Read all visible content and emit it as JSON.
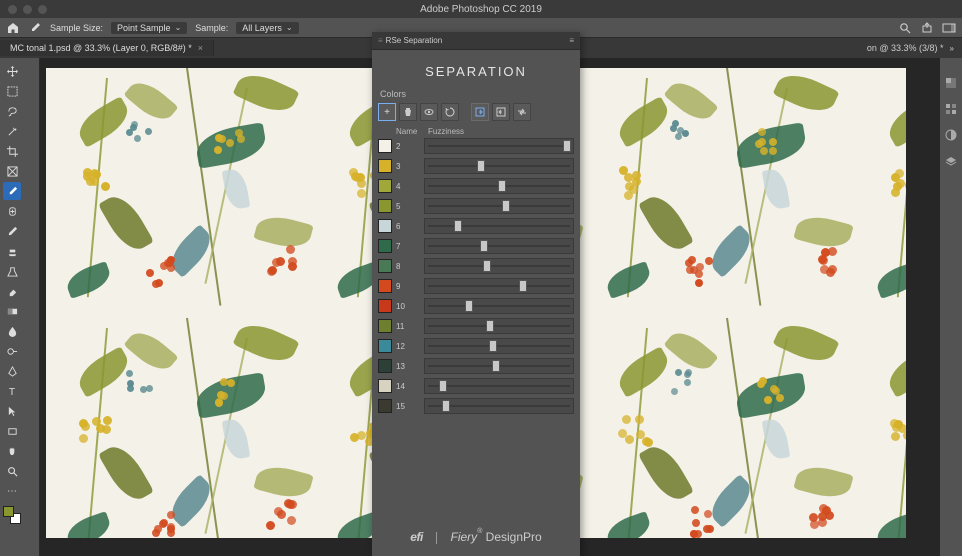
{
  "app": {
    "title": "Adobe Photoshop CC 2019"
  },
  "optionsBar": {
    "sampleSizeLabel": "Sample Size:",
    "sampleSizeValue": "Point Sample",
    "sampleLabel": "Sample:",
    "sampleValue": "All Layers"
  },
  "tabs": {
    "doc1": "MC tonal 1.psd @ 33.3% (Layer 0, RGB/8#) *",
    "doc2_fragment": "on @ 33.3% (3/8) *"
  },
  "separation": {
    "panelTab": "RSe Separation",
    "title": "SEPARATION",
    "sectionLabel": "Colors",
    "headers": {
      "name": "Name",
      "fuzziness": "Fuzziness"
    },
    "rows": [
      {
        "id": "2",
        "color": "#f4f1e8",
        "fuzz": 96
      },
      {
        "id": "3",
        "color": "#d6b22a",
        "fuzz": 38
      },
      {
        "id": "4",
        "color": "#a0a83a",
        "fuzz": 52
      },
      {
        "id": "5",
        "color": "#8a9730",
        "fuzz": 55
      },
      {
        "id": "6",
        "color": "#c7d6d8",
        "fuzz": 22
      },
      {
        "id": "7",
        "color": "#2f6b4a",
        "fuzz": 40
      },
      {
        "id": "8",
        "color": "#4a7a55",
        "fuzz": 42
      },
      {
        "id": "9",
        "color": "#d24a1e",
        "fuzz": 66
      },
      {
        "id": "10",
        "color": "#c8381a",
        "fuzz": 30
      },
      {
        "id": "11",
        "color": "#6e8030",
        "fuzz": 44
      },
      {
        "id": "12",
        "color": "#3a8a9a",
        "fuzz": 46
      },
      {
        "id": "13",
        "color": "#2c4038",
        "fuzz": 48
      },
      {
        "id": "14",
        "color": "#d8d2c0",
        "fuzz": 12
      },
      {
        "id": "15",
        "color": "#3a3a30",
        "fuzz": 14
      }
    ],
    "footerBrand": {
      "efi": "efi",
      "fiery": "Fiery",
      "designpro": "DesignPro"
    }
  }
}
